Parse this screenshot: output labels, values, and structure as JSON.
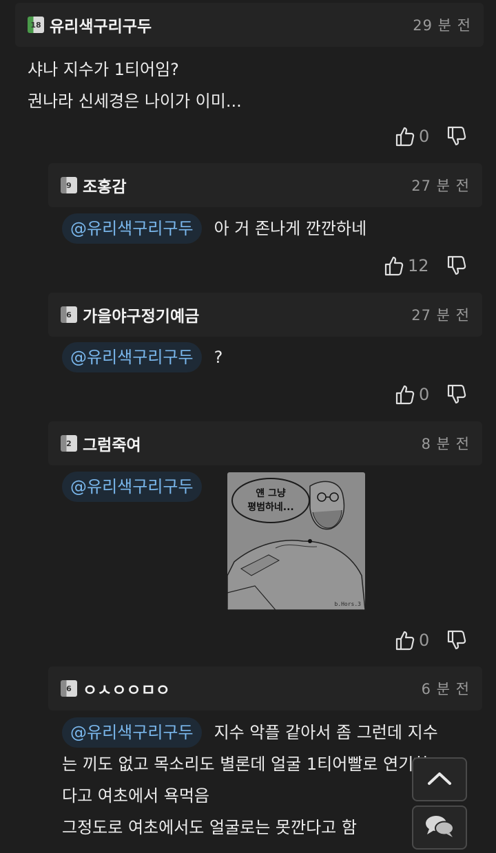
{
  "comments": [
    {
      "level": "18",
      "nick": "유리색구리구두",
      "time": "29 분 전",
      "lines": [
        "샤나 지수가 1티어임?",
        "권나라 신세경은 나이가 이미..."
      ],
      "up": "0"
    },
    {
      "level": "9",
      "nick": "조홍감",
      "time": "27 분 전",
      "mention": "@유리색구리구두",
      "text": "아 거 존나게 깐깐하네",
      "up": "12"
    },
    {
      "level": "6",
      "nick": "가을야구정기예금",
      "time": "27 분 전",
      "mention": "@유리색구리구두",
      "text": "?",
      "up": "0"
    },
    {
      "level": "2",
      "nick": "그럼죽여",
      "time": "8 분 전",
      "mention": "@유리색구리구두",
      "image_bubble": [
        "얜 그냥",
        "평범하네..."
      ],
      "image_signature": "b.Hors.3",
      "up": "0"
    },
    {
      "level": "6",
      "nick": "ㅇㅅㅇㅇㅁㅇ",
      "time": "6 분 전",
      "mention": "@유리색구리구두",
      "text": "지수 악플 같아서 좀 그런데 지수",
      "lines": [
        "는 끼도 없고 목소리도 별론데 얼굴 1티어빨로 연기한",
        "다고 여초에서 욕먹음",
        "그정도로 여초에서도 얼굴로는 못깐다고 함"
      ]
    }
  ],
  "icons": {
    "upvote": "thumbs-up-icon",
    "downvote": "thumbs-down-icon",
    "scroll_top": "chevron-up-icon",
    "chat": "chat-bubbles-icon"
  },
  "colors": {
    "background": "#1e1e1e",
    "header": "#242424",
    "mention_text": "#7ab7ec",
    "mention_bg": "#1e2a36",
    "level_green": "#4a9a4a"
  }
}
